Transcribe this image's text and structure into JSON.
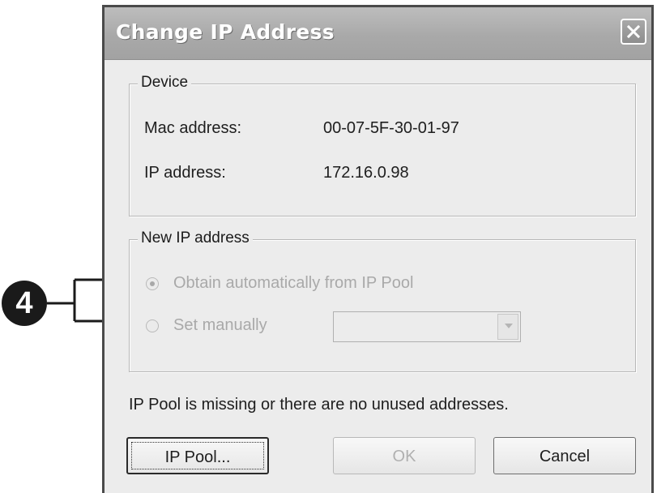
{
  "window": {
    "title": "Change IP Address"
  },
  "device_group": {
    "legend": "Device",
    "mac_label": "Mac address:",
    "mac_value": "00-07-5F-30-01-97",
    "ip_label": "IP address:",
    "ip_value": "172.16.0.98"
  },
  "new_ip_group": {
    "legend": "New IP address",
    "option_auto": "Obtain automatically from IP Pool",
    "option_manual": "Set manually",
    "selected": "option_auto",
    "manual_select_value": ""
  },
  "status_message": "IP Pool is missing or there are no unused addresses.",
  "buttons": {
    "ip_pool": "IP Pool...",
    "ok": "OK",
    "cancel": "Cancel"
  },
  "callout": {
    "number": "4"
  },
  "icons": {
    "close": "close-icon",
    "dropdown": "chevron-down-icon"
  }
}
